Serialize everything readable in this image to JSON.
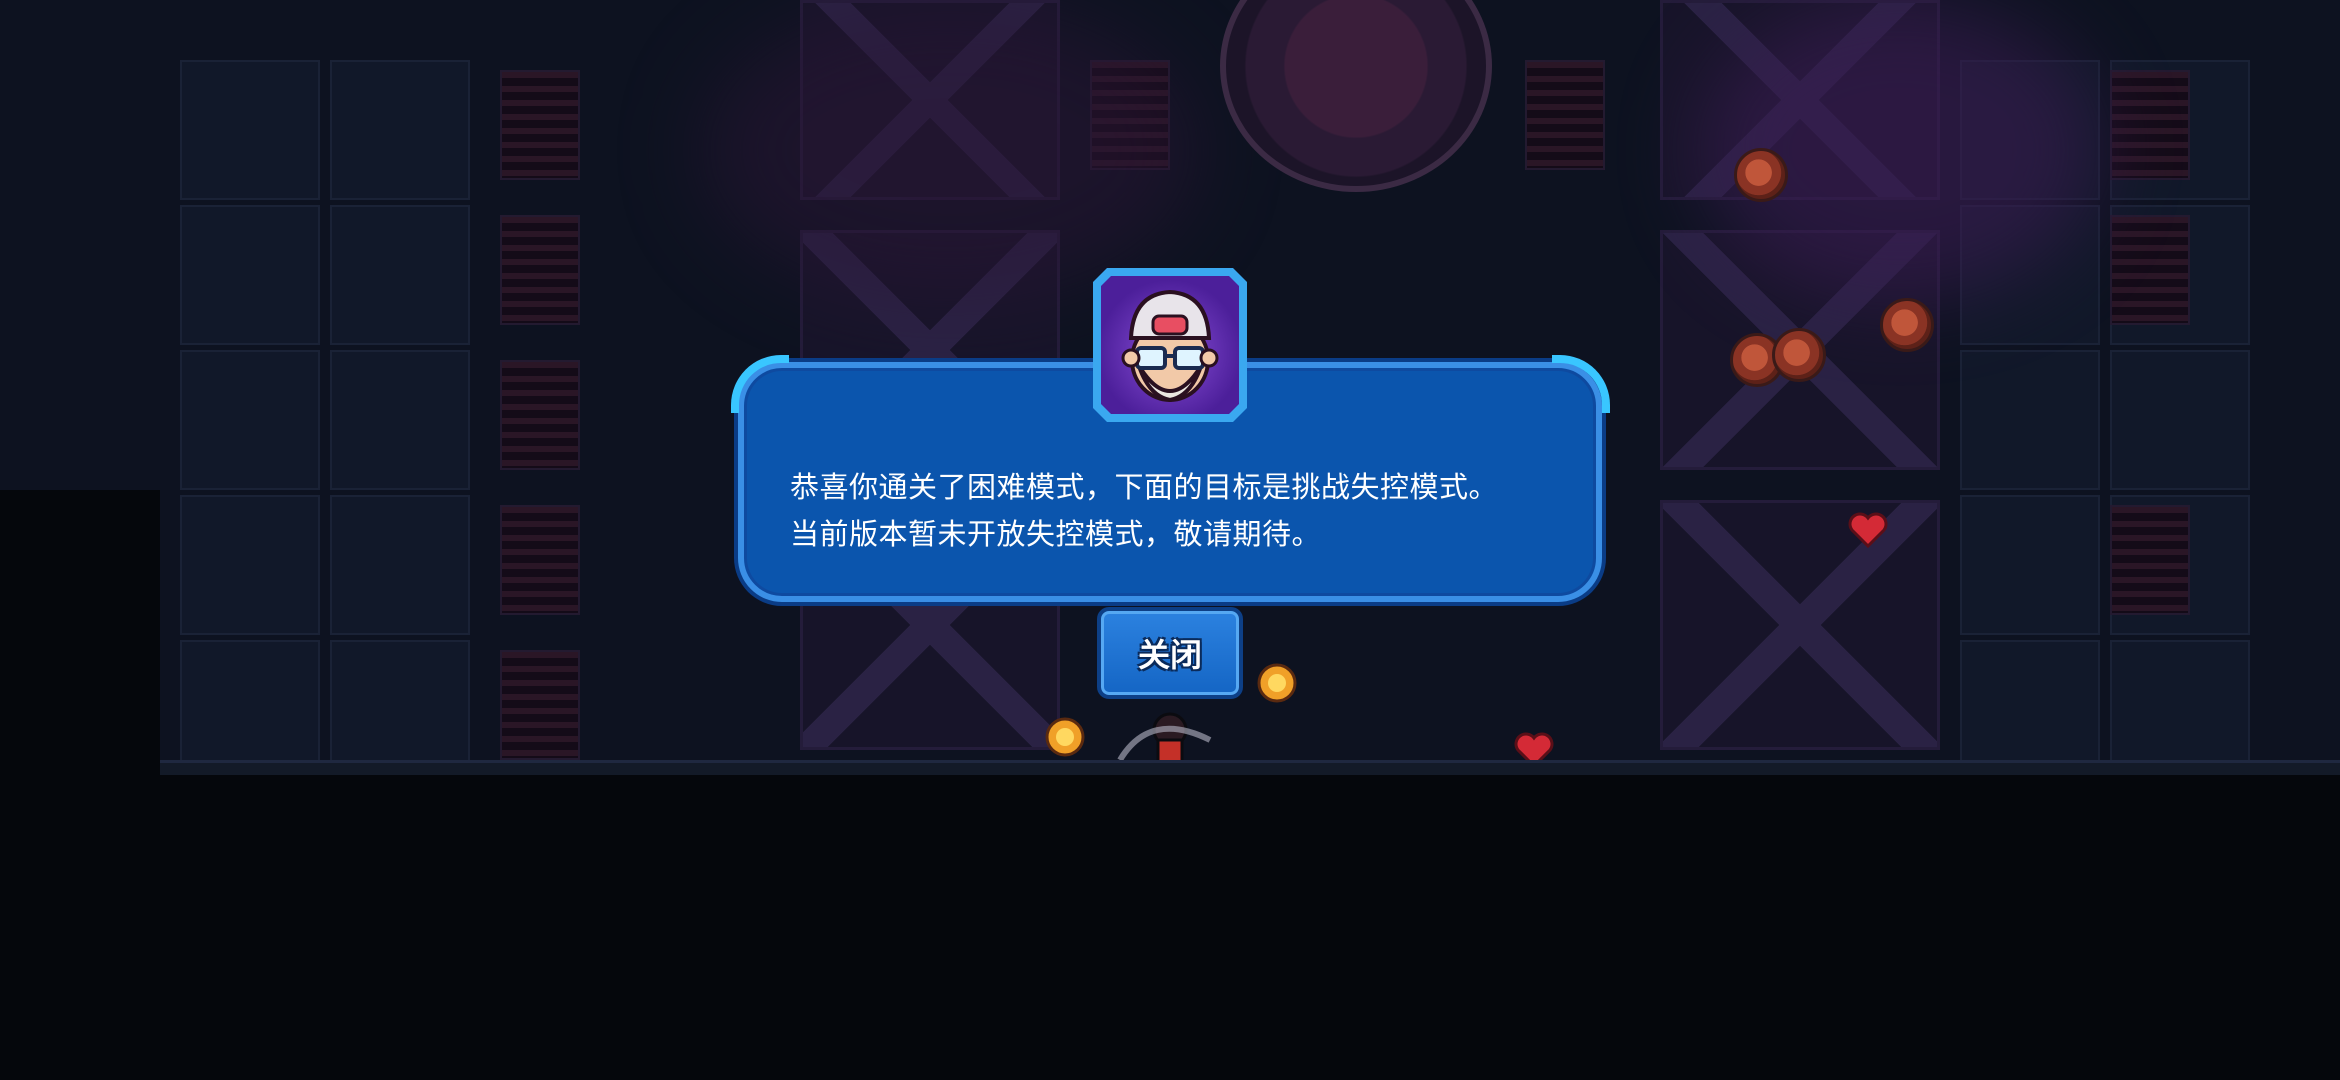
{
  "dialog": {
    "message_line1": "恭喜你通关了困难模式，下面的目标是挑战失控模式。",
    "message_line2": "当前版本暂未开放失控模式，敬请期待。",
    "close_label": "关闭"
  },
  "colors": {
    "dialog_fill": "#0b55ad",
    "dialog_border": "#3a8fe6",
    "corner_accent": "#39c6ff",
    "button_fill": "#1e73d4",
    "avatar_bg": "#6a36c0"
  },
  "icons": {
    "avatar": "old-man-with-cap-and-glasses-icon",
    "pickups": [
      "coin-icon",
      "heart-icon"
    ]
  }
}
